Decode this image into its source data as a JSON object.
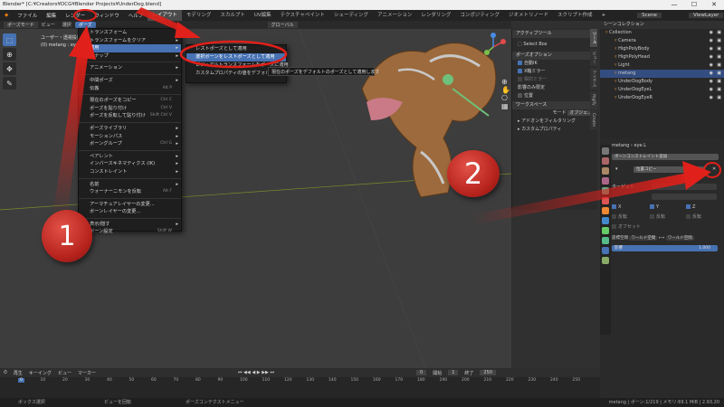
{
  "window": {
    "title": "Blender* [C:¥Creators¥DCG¥Blender Projects¥UnderDog.blend]",
    "controls": [
      "—",
      "☐",
      "✕"
    ]
  },
  "menubar": {
    "items": [
      "ファイル",
      "編集",
      "レンダー",
      "ウィンドウ",
      "ヘルプ"
    ],
    "workspaces": [
      "レイアウト",
      "モデリング",
      "スカルプト",
      "UV編集",
      "テクスチャペイント",
      "シェーディング",
      "アニメーション",
      "レンダリング",
      "コンポジティング",
      "ジオメトリノード",
      "スクリプト作成"
    ],
    "scene": "Scene",
    "viewlayer": "ViewLayer"
  },
  "viewport_header": {
    "mode": "ポーズモード",
    "view": "ビュー",
    "select": "選択",
    "pose": "ポーズ",
    "transform": "グローバル"
  },
  "viewport_info": {
    "line1": "ユーザー・透視投影",
    "line2": "(0) metang : eye.L"
  },
  "pose_menu": {
    "items": [
      {
        "label": "トランスフォーム",
        "shortcut": "",
        "arrow": "▸"
      },
      {
        "label": "トランスフォームをクリア",
        "shortcut": "",
        "arrow": "▸"
      },
      {
        "label": "適用",
        "shortcut": "",
        "arrow": "▸",
        "selected": true
      },
      {
        "label": "スナップ",
        "shortcut": "",
        "arrow": "▸"
      },
      {
        "sep": true
      },
      {
        "label": "アニメーション",
        "shortcut": "",
        "arrow": "▸"
      },
      {
        "sep": true
      },
      {
        "label": "中間ポーズ",
        "shortcut": "",
        "arrow": "▸"
      },
      {
        "label": "伝搬",
        "shortcut": "Alt P",
        "arrow": ""
      },
      {
        "sep": true
      },
      {
        "label": "現在のポーズをコピー",
        "shortcut": "Ctrl C",
        "arrow": ""
      },
      {
        "label": "ポーズを貼り付け",
        "shortcut": "Ctrl V",
        "arrow": ""
      },
      {
        "label": "ポーズを反転して貼り付け",
        "shortcut": "Shift Ctrl V",
        "arrow": ""
      },
      {
        "sep": true
      },
      {
        "label": "ポーズライブラリ",
        "shortcut": "",
        "arrow": "▸"
      },
      {
        "label": "モーションパス",
        "shortcut": "",
        "arrow": "▸"
      },
      {
        "label": "ボーングループ",
        "shortcut": "Ctrl G",
        "arrow": "▸"
      },
      {
        "sep": true
      },
      {
        "label": "ペアレント",
        "shortcut": "",
        "arrow": "▸"
      },
      {
        "label": "インバースキネマティクス (IK)",
        "shortcut": "",
        "arrow": "▸"
      },
      {
        "label": "コンストレイント",
        "shortcut": "",
        "arrow": "▸"
      },
      {
        "sep": true
      },
      {
        "label": "名前",
        "shortcut": "",
        "arrow": "▸"
      },
      {
        "label": "ウォーナーニモンを反転",
        "shortcut": "Alt F",
        "arrow": ""
      },
      {
        "sep": true
      },
      {
        "label": "アーマチュアレイヤーの変更...",
        "shortcut": "",
        "arrow": ""
      },
      {
        "label": "ボーンレイヤーの変更...",
        "shortcut": "",
        "arrow": ""
      },
      {
        "sep": true
      },
      {
        "label": "表示/隠す",
        "shortcut": "",
        "arrow": "▸"
      },
      {
        "label": "ボーン設定",
        "shortcut": "Shift W",
        "arrow": ""
      }
    ]
  },
  "apply_submenu": {
    "items": [
      {
        "label": "レストポーズとして適用"
      },
      {
        "label": "選択ボーンをレストポーズとして適用",
        "selected": true
      },
      {
        "label": "ビジュアルトランスフォームをポーズに適用"
      },
      {
        "label": "カスタムプロパティの値をデフォルトに"
      }
    ]
  },
  "tooltip": "現在のポーズをデフォルトのポーズとして適用します",
  "npanel": {
    "active_tool_header": "アクティブツール",
    "select_box": "Select Box",
    "pose_options_header": "ポーズオプション",
    "auto_ik": "自動IK",
    "x_mirror": "X軸ミラー",
    "relative": "相対ミラー",
    "affect_only": "影響のみ限定",
    "locations": "位置",
    "workspace_header": "ワークスペース",
    "mode_label": "モード",
    "object_label": "オブジェ...",
    "addon_filter": "アドオンをフィルタリング",
    "custom_props": "カスタムプロパティ",
    "tabs": [
      "ツール",
      "ビュー",
      "アイテム",
      "Rigify",
      "Create"
    ]
  },
  "outliner": {
    "header": "シーンコレクション",
    "rows": [
      {
        "label": "Collection",
        "indent": 0
      },
      {
        "label": "Camera",
        "indent": 1
      },
      {
        "label": "HighPolyBody",
        "indent": 1
      },
      {
        "label": "HighPolyHead",
        "indent": 1
      },
      {
        "label": "Light",
        "indent": 1
      },
      {
        "label": "metang",
        "indent": 1,
        "highlight": true
      },
      {
        "label": "UnderDogBody",
        "indent": 1
      },
      {
        "label": "UnderDogEyeL",
        "indent": 1
      },
      {
        "label": "UnderDogEyeR",
        "indent": 1
      }
    ]
  },
  "properties": {
    "breadcrumb1": "metang",
    "breadcrumb2": "eye.L",
    "add_constraint": "ボーンコンストレイント追加",
    "constraint_name": "位置コピー",
    "target_label": "ターゲット",
    "axis": [
      "X",
      "Y",
      "Z"
    ],
    "invert": "反転",
    "offset": "オフセット",
    "mix_label": "座標空間",
    "world_space": "ワールド空間",
    "arrow": "⟷",
    "world_space2": "ワールド空間",
    "influence_label": "影響",
    "influence_value": "1.000"
  },
  "timeline": {
    "header": [
      "再生",
      "キーイング",
      "ビュー",
      "マーカー"
    ],
    "current_frame": "0",
    "start_label": "開始",
    "start": "1",
    "end_label": "終了",
    "end": "250",
    "ticks": [
      "0",
      "10",
      "20",
      "30",
      "40",
      "50",
      "60",
      "70",
      "80",
      "90",
      "100",
      "110",
      "120",
      "130",
      "140",
      "150",
      "160",
      "170",
      "180",
      "190",
      "200",
      "210",
      "220",
      "230",
      "240",
      "250"
    ]
  },
  "statusbar": {
    "left": "ボックス選択",
    "mid": "ビューを回転",
    "right_action": "ポーズコンテクストメニュー",
    "right": "metang | ボーン:1/219 | メモリ:69.1 MiB | 2.93.20"
  },
  "badges": {
    "one": "1",
    "two": "2"
  },
  "colors": {
    "selected": "#4772b3",
    "annotation_red": "#e0201a",
    "badge_red": "#c72a22"
  }
}
